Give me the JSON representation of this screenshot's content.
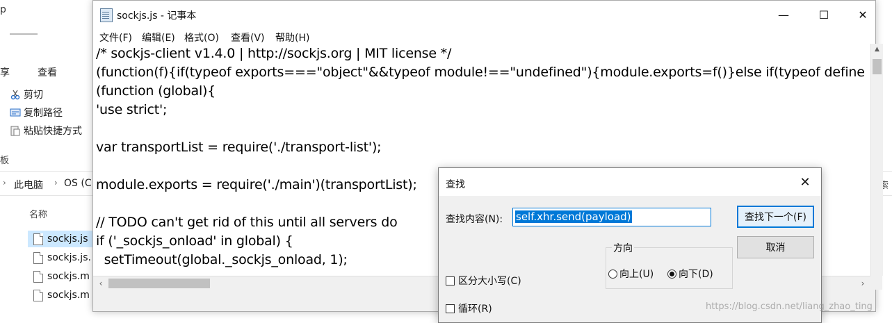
{
  "explorer": {
    "title_fragment": "p",
    "ribbon_tabs": [
      "享",
      "查看"
    ],
    "clipboard_commands": [
      {
        "icon": "scissors-icon",
        "label": "剪切"
      },
      {
        "icon": "copy-path-icon",
        "label": "复制路径"
      },
      {
        "icon": "paste-shortcut-icon",
        "label": "粘贴快捷方式"
      }
    ],
    "group_fragment": "板",
    "breadcrumb": [
      "此电脑",
      "OS (C:"
    ],
    "right_fragment": "索",
    "column_header": "名称",
    "files": [
      "sockjs.js",
      "sockjs.js.",
      "sockjs.m",
      "sockjs.m"
    ],
    "selected_file_index": 0
  },
  "notepad": {
    "title": "sockjs.js - 记事本",
    "menu": [
      "文件(F)",
      "编辑(E)",
      "格式(O)",
      "查看(V)",
      "帮助(H)"
    ],
    "lines": [
      "/* sockjs-client v1.4.0 | http://sockjs.org | MIT license */",
      "(function(f){if(typeof exports===\"object\"&&typeof module!==\"undefined\"){module.exports=f()}else if(typeof define",
      "(function (global){",
      "'use strict';",
      "",
      "var transportList = require('./transport-list');",
      "",
      "module.exports = require('./main')(transportList);",
      "",
      "// TODO can't get rid of this until all servers do",
      "if ('_sockjs_onload' in global) {",
      "  setTimeout(global._sockjs_onload, 1);"
    ],
    "window_buttons": {
      "minimize": "—",
      "maximize": "☐",
      "close": "✕"
    }
  },
  "find_dialog": {
    "title": "查找",
    "close_glyph": "✕",
    "find_label": "查找内容(N):",
    "find_value": "self.xhr.send(payload)",
    "find_next_button": "查找下一个(F)",
    "cancel_button": "取消",
    "direction_title": "方向",
    "direction_up": "向上(U)",
    "direction_down": "向下(D)",
    "direction_selected": "down",
    "match_case": "区分大小写(C)",
    "match_case_checked": false,
    "wrap": "循环(R)",
    "wrap_checked": false
  },
  "watermark": "https://blog.csdn.net/liang_zhao_ting"
}
